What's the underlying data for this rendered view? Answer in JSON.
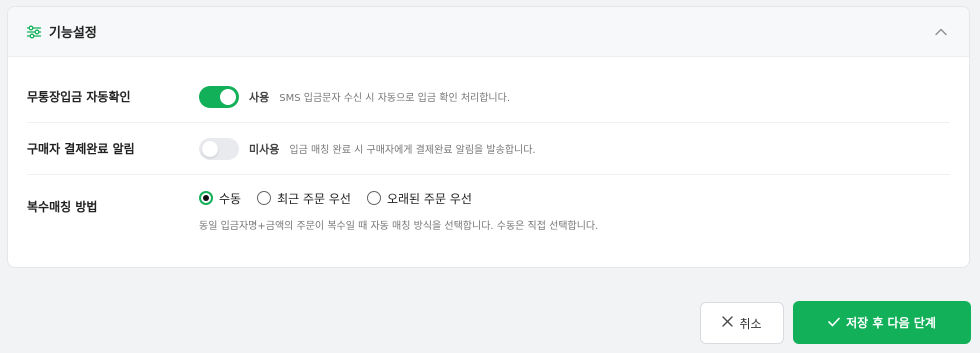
{
  "section": {
    "title": "기능설정",
    "header_icon": "sliders-icon",
    "collapse_icon": "chevron-up-icon"
  },
  "settings": {
    "auto_confirm": {
      "label": "무통장입금 자동확인",
      "enabled": true,
      "state_text": "사용",
      "description": "SMS 입금문자 수신 시 자동으로 입금 확인 처리합니다."
    },
    "buyer_alert": {
      "label": "구매자 결제완료 알림",
      "enabled": false,
      "state_text": "미사용",
      "description": "입금 매칭 완료 시 구매자에게 결제완료 알림을 발송합니다."
    },
    "multi_match": {
      "label": "복수매칭 방법",
      "options": [
        "수동",
        "최근 주문 우선",
        "오래된 주문 우선"
      ],
      "selected": "수동",
      "hint": "동일 입금자명+금액의 주문이 복수일 때 자동 매칭 방식을 선택합니다. 수동은 직접 선택합니다."
    }
  },
  "actions": {
    "cancel_label": "취소",
    "save_label": "저장 후 다음 단계"
  },
  "colors": {
    "accent": "#13b05a",
    "toggle_off": "#e8eaed"
  }
}
